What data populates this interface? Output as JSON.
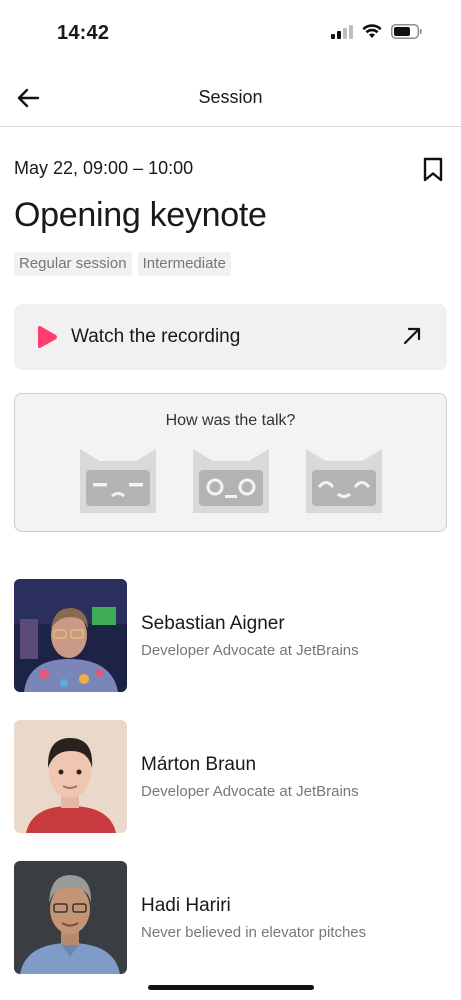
{
  "status_bar": {
    "time": "14:42"
  },
  "nav": {
    "title": "Session",
    "back_icon": "back-arrow-icon"
  },
  "session": {
    "datetime": "May 22, 09:00 – 10:00",
    "title": "Opening keynote",
    "tags": [
      "Regular session",
      "Intermediate"
    ],
    "bookmark_icon": "bookmark-icon"
  },
  "recording": {
    "label": "Watch the recording",
    "play_icon": "play-icon",
    "open_icon": "external-arrow-icon",
    "accent_color": "#ff3d6e"
  },
  "feedback": {
    "question": "How was the talk?",
    "options": [
      "bad",
      "neutral",
      "good"
    ]
  },
  "speakers": [
    {
      "name": "Sebastian Aigner",
      "role": "Developer Advocate at JetBrains"
    },
    {
      "name": "Márton Braun",
      "role": "Developer Advocate at JetBrains"
    },
    {
      "name": "Hadi Hariri",
      "role": "Never believed in elevator pitches"
    }
  ]
}
